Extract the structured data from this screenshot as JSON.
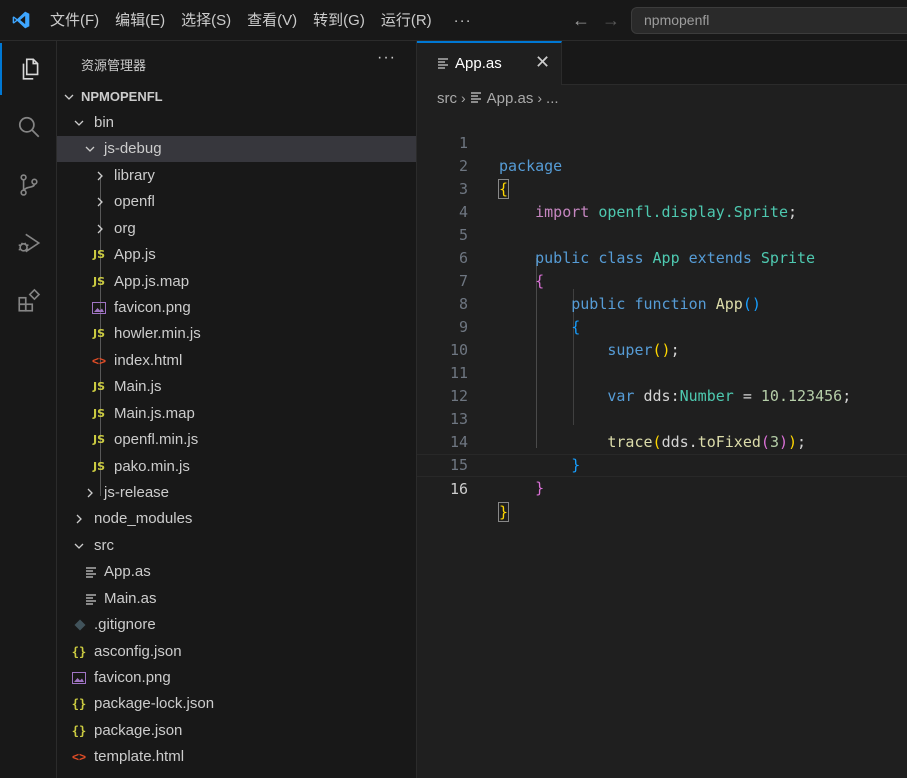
{
  "menu": [
    "文件(F)",
    "编辑(E)",
    "选择(S)",
    "查看(V)",
    "转到(G)",
    "运行(R)"
  ],
  "menu_more": "···",
  "search": {
    "text": "npmopenfl"
  },
  "activity": [
    "explorer-icon",
    "search-icon",
    "source-control-icon",
    "run-debug-icon",
    "extensions-icon"
  ],
  "sidebar": {
    "title": "资源管理器",
    "more": "···",
    "tree": [
      {
        "label": "NPMOPENFL",
        "icon": "chevron-down"
      },
      {
        "label": "bin",
        "icon": "chevron-down"
      },
      {
        "label": "js-debug",
        "icon": "chevron-down"
      },
      {
        "label": "library",
        "icon": "chevron-right"
      },
      {
        "label": "openfl",
        "icon": "chevron-right"
      },
      {
        "label": "org",
        "icon": "chevron-right"
      },
      {
        "label": "App.js",
        "icon": "JS"
      },
      {
        "label": "App.js.map",
        "icon": "JS"
      },
      {
        "label": "favicon.png",
        "icon": "image"
      },
      {
        "label": "howler.min.js",
        "icon": "JS"
      },
      {
        "label": "index.html",
        "icon": "<>"
      },
      {
        "label": "Main.js",
        "icon": "JS"
      },
      {
        "label": "Main.js.map",
        "icon": "JS"
      },
      {
        "label": "openfl.min.js",
        "icon": "JS"
      },
      {
        "label": "pako.min.js",
        "icon": "JS"
      },
      {
        "label": "js-release",
        "icon": "chevron-right"
      },
      {
        "label": "node_modules",
        "icon": "chevron-right"
      },
      {
        "label": "src",
        "icon": "chevron-down"
      },
      {
        "label": "App.as",
        "icon": "lines"
      },
      {
        "label": "Main.as",
        "icon": "lines"
      },
      {
        "label": ".gitignore",
        "icon": "diamond"
      },
      {
        "label": "asconfig.json",
        "icon": "{}"
      },
      {
        "label": "favicon.png",
        "icon": "image"
      },
      {
        "label": "package-lock.json",
        "icon": "{}"
      },
      {
        "label": "package.json",
        "icon": "{}"
      },
      {
        "label": "template.html",
        "icon": "<>"
      }
    ]
  },
  "editor": {
    "tab_label": "App.as",
    "tab_close": "✕",
    "breadcrumb": [
      "src",
      "App.as",
      "..."
    ],
    "line_numbers": [
      "1",
      "2",
      "3",
      "4",
      "5",
      "6",
      "7",
      "8",
      "9",
      "10",
      "11",
      "12",
      "13",
      "14",
      "15",
      "16"
    ],
    "tokens": {
      "package": "package",
      "import": "import",
      "import_path": "openfl.display.Sprite",
      "public": "public",
      "class": "class",
      "class_name": "App",
      "extends": "extends",
      "super_class": "Sprite",
      "function": "function",
      "func_name": "App",
      "super": "super",
      "var": "var",
      "var_name": "dds",
      "type": "Number",
      "value": "10.123456",
      "trace": "trace",
      "method": "toFixed",
      "arg": "3"
    }
  },
  "colors": {
    "accent": "#0078d4",
    "keyword": "#569cd6",
    "control": "#c586c0",
    "type": "#4ec9b0",
    "function": "#dcdcaa",
    "number": "#b5cea8"
  }
}
